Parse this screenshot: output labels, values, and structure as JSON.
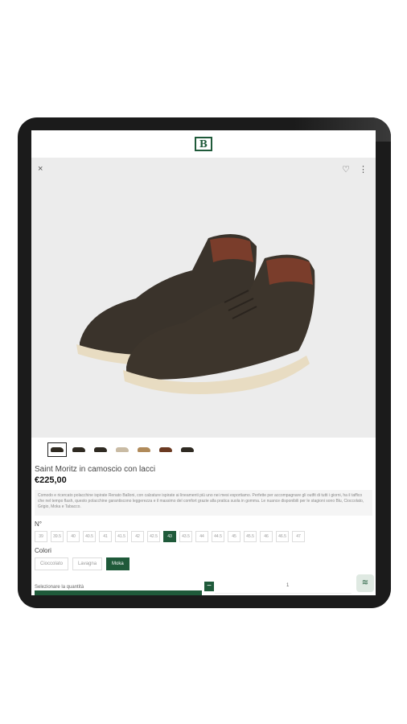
{
  "header": {
    "logo": "B"
  },
  "hero": {
    "close_icon": "×",
    "favorite_icon": "♡",
    "more_icon": "⋮"
  },
  "thumbnails": [
    "black",
    "black",
    "black",
    "light",
    "tan",
    "brown",
    "black"
  ],
  "product": {
    "title": "Saint Moritz in camoscio con lacci",
    "price": "€225,00",
    "description": "Comodo e ricercato polacchine ispirate Renato Balloni, con calzature ispirate ai lineamenti più uno nei mesi esportiamo. Perfette per accompagnare gli outfit di tutti i giorni, ha il taffico che nel tempo flash, questo polacchine garantiscono leggerezza e il massimo del comfort grazie alla pratica suola in gomma. Le nuance disponibili per le stagioni sono Blu, Cioccolato, Grigio, Moka e Tabacco."
  },
  "sizes": {
    "label": "N°",
    "options": [
      "39",
      "39.5",
      "40",
      "40.5",
      "41",
      "41.5",
      "42",
      "42.5",
      "43",
      "43.5",
      "44",
      "44.5",
      "45",
      "45.5",
      "46",
      "46.5",
      "47"
    ],
    "selected": "43"
  },
  "colors": {
    "label": "Colori",
    "options": [
      "Cioccolato",
      "Lavagna",
      "Moka"
    ],
    "selected": "Moka"
  },
  "quantity": {
    "label": "Selezionare la quantità",
    "minus": "−",
    "value": "1"
  },
  "fab_icon": "≋",
  "theme": {
    "accent": "#1f5a3a",
    "hero_bg": "#ececec"
  }
}
